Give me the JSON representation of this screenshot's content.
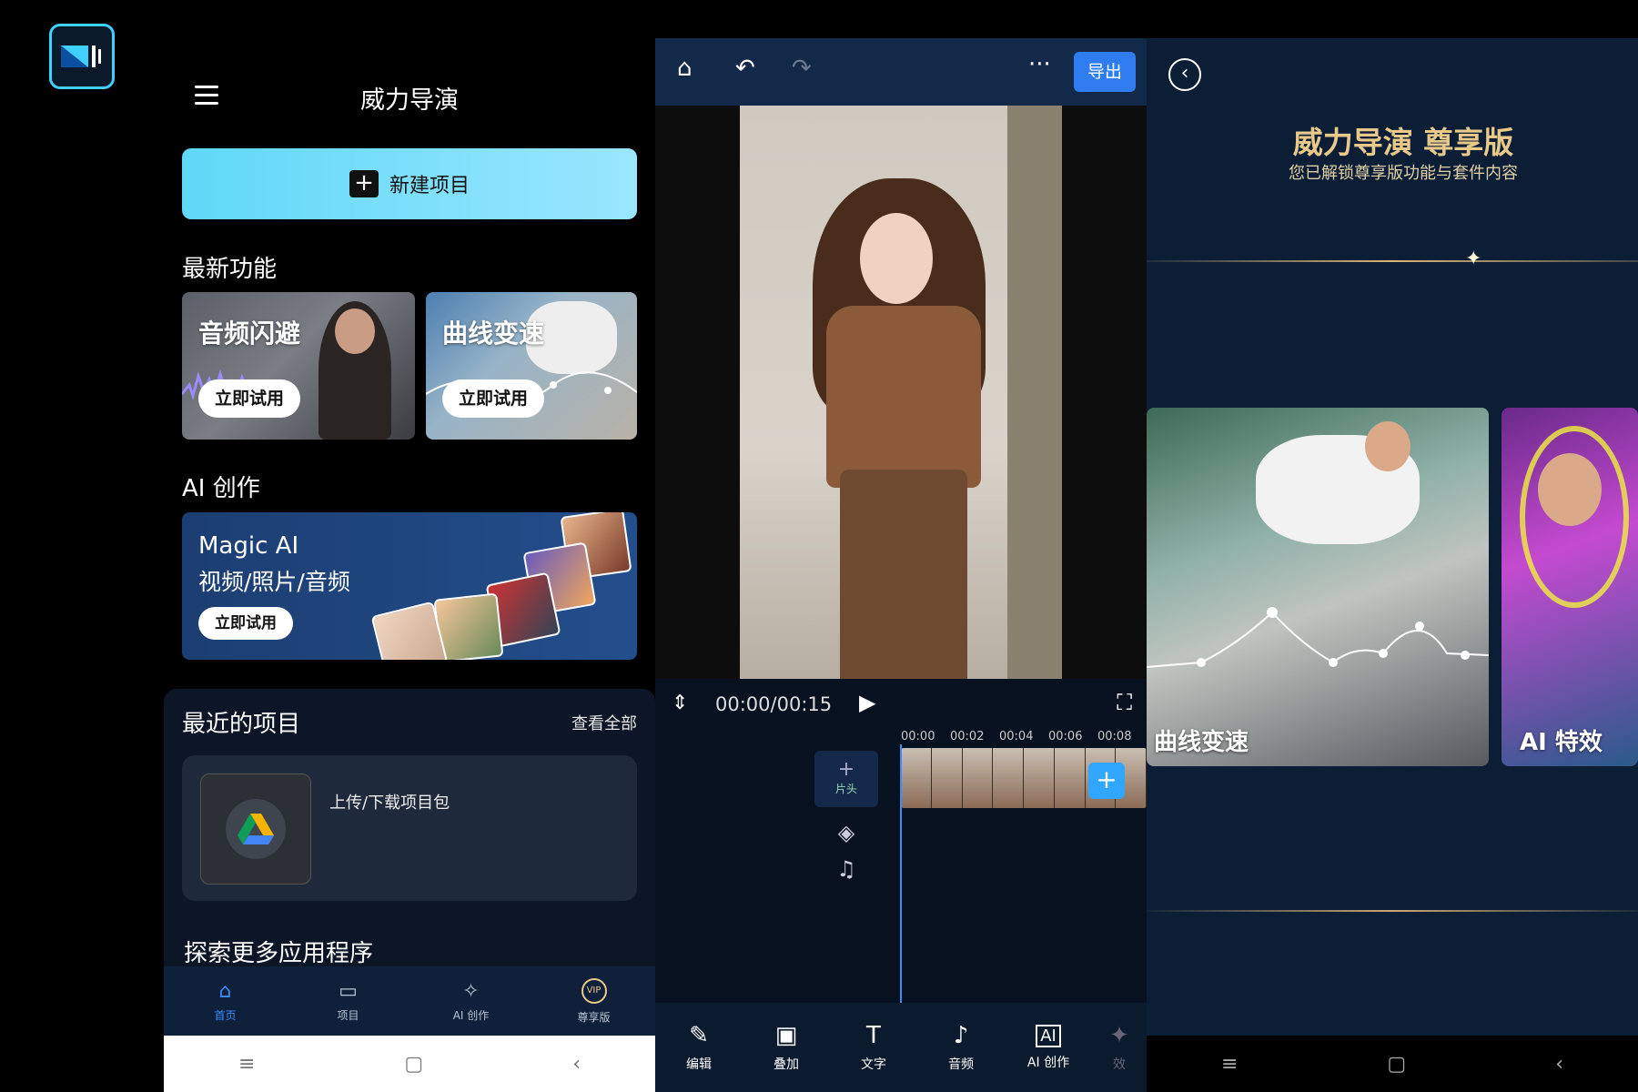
{
  "home": {
    "title": "威力导演",
    "new_project": "新建项目",
    "latest_section": "最新功能",
    "feature_cards": [
      {
        "title": "音频闪避",
        "button": "立即试用"
      },
      {
        "title": "曲线变速",
        "button": "立即试用"
      }
    ],
    "ai_section": "AI 创作",
    "ai_card": {
      "line1": "Magic AI",
      "line2": "视频/照片/音频",
      "button": "立即试用"
    },
    "recent_section": "最近的项目",
    "see_all": "查看全部",
    "upload_label": "上传/下载项目包",
    "explore_section": "探索更多应用程序",
    "tabs": [
      {
        "label": "首页",
        "icon": "home-icon",
        "active": true
      },
      {
        "label": "项目",
        "icon": "folder-icon",
        "active": false
      },
      {
        "label": "AI 创作",
        "icon": "sparkle-icon",
        "active": false
      },
      {
        "label": "尊享版",
        "icon": "vip-icon",
        "active": false
      }
    ]
  },
  "editor": {
    "export": "导出",
    "timecode": "00:00/00:15",
    "ruler": [
      "00:00",
      "00:02",
      "00:04",
      "00:06",
      "00:08"
    ],
    "side_label": "片头",
    "tools": [
      {
        "label": "编辑",
        "icon": "edit-icon"
      },
      {
        "label": "叠加",
        "icon": "overlay-icon"
      },
      {
        "label": "文字",
        "icon": "text-icon"
      },
      {
        "label": "音频",
        "icon": "audio-icon"
      },
      {
        "label": "AI 创作",
        "icon": "ai-icon"
      },
      {
        "label": "效",
        "icon": "effect-icon"
      }
    ]
  },
  "premium": {
    "title": "威力导演 尊享版",
    "subtitle": "您已解锁尊享版功能与套件内容",
    "cards": [
      {
        "caption": "曲线变速"
      },
      {
        "caption": "AI 特效"
      }
    ]
  },
  "colors": {
    "accent": "#3b8cff",
    "gold": "#e8c98a",
    "new_btn": "#5fd8f7",
    "export_btn": "#2f7cf0"
  }
}
